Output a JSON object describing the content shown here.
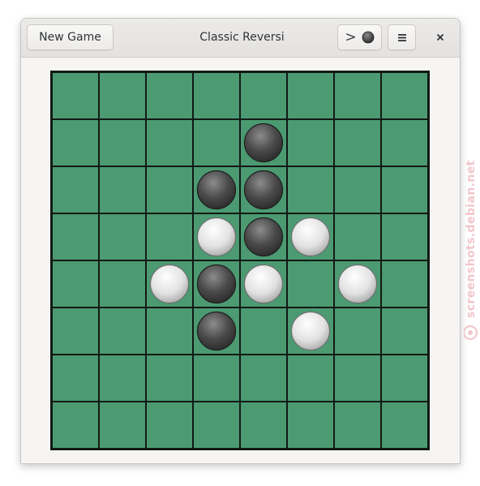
{
  "window": {
    "title": "Classic Reversi"
  },
  "header": {
    "new_game_label": "New Game",
    "turn_indicator_arrow": ">",
    "turn_indicator_piece": "dark",
    "menu_icon": "hamburger-menu-icon",
    "close_icon": "close-icon"
  },
  "board": {
    "size": 8,
    "colors": {
      "felt": "#4c9a72",
      "grid": "#1e3a2a",
      "border": "#111a14"
    },
    "pieces": [
      {
        "row": 1,
        "col": 4,
        "color": "dark"
      },
      {
        "row": 2,
        "col": 3,
        "color": "dark"
      },
      {
        "row": 2,
        "col": 4,
        "color": "dark"
      },
      {
        "row": 3,
        "col": 3,
        "color": "light"
      },
      {
        "row": 3,
        "col": 4,
        "color": "dark"
      },
      {
        "row": 3,
        "col": 5,
        "color": "light"
      },
      {
        "row": 4,
        "col": 2,
        "color": "light"
      },
      {
        "row": 4,
        "col": 3,
        "color": "dark"
      },
      {
        "row": 4,
        "col": 4,
        "color": "light"
      },
      {
        "row": 4,
        "col": 6,
        "color": "light"
      },
      {
        "row": 5,
        "col": 3,
        "color": "dark"
      },
      {
        "row": 5,
        "col": 5,
        "color": "light"
      }
    ]
  },
  "watermark": {
    "text": "screenshots.debian.net"
  }
}
